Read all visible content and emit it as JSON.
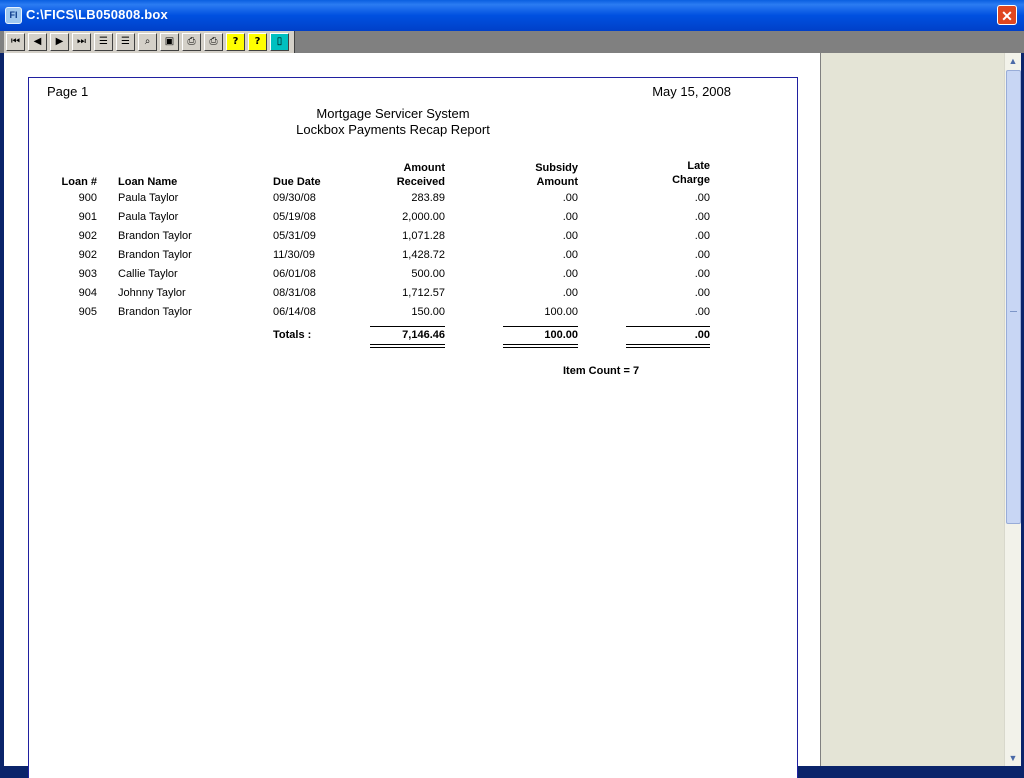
{
  "window": {
    "title": "C:\\FICS\\LB050808.box",
    "icon": "document-viewer-icon"
  },
  "toolbar": {
    "buttons": [
      {
        "name": "first-page-button",
        "glyph": "⏮"
      },
      {
        "name": "prev-page-button",
        "glyph": "◀"
      },
      {
        "name": "next-page-button",
        "glyph": "▶"
      },
      {
        "name": "last-page-button",
        "glyph": "⏭"
      },
      {
        "name": "page-button",
        "glyph": "☰"
      },
      {
        "name": "pages-button",
        "glyph": "☰"
      },
      {
        "name": "find-button",
        "glyph": "⌕"
      },
      {
        "name": "save-button",
        "glyph": "▣"
      },
      {
        "name": "print-setup-button",
        "glyph": "⎙"
      },
      {
        "name": "print-button",
        "glyph": "⎙"
      },
      {
        "name": "help-button",
        "glyph": "?"
      },
      {
        "name": "help-topics-button",
        "glyph": "?"
      },
      {
        "name": "exit-button",
        "glyph": "▯"
      }
    ]
  },
  "report": {
    "page_label": "Page 1",
    "date": "May 15, 2008",
    "title_line1": "Mortgage Servicer System",
    "title_line2": "Lockbox Payments Recap Report",
    "headers": {
      "loan_num": "Loan #",
      "loan_name": "Loan Name",
      "due_date": "Due Date",
      "amount_top": "Amount",
      "amount_bottom": "Received",
      "subsidy_top": "Subsidy",
      "subsidy_bottom": "Amount",
      "late_top": "Late",
      "late_bottom": "Charge"
    },
    "rows": [
      {
        "loan": "900",
        "name": "Paula Taylor",
        "due": "09/30/08",
        "amount": "283.89",
        "subsidy": ".00",
        "late": ".00"
      },
      {
        "loan": "901",
        "name": "Paula Taylor",
        "due": "05/19/08",
        "amount": "2,000.00",
        "subsidy": ".00",
        "late": ".00"
      },
      {
        "loan": "902",
        "name": "Brandon Taylor",
        "due": "05/31/09",
        "amount": "1,071.28",
        "subsidy": ".00",
        "late": ".00"
      },
      {
        "loan": "902",
        "name": "Brandon Taylor",
        "due": "11/30/09",
        "amount": "1,428.72",
        "subsidy": ".00",
        "late": ".00"
      },
      {
        "loan": "903",
        "name": "Callie Taylor",
        "due": "06/01/08",
        "amount": "500.00",
        "subsidy": ".00",
        "late": ".00"
      },
      {
        "loan": "904",
        "name": "Johnny Taylor",
        "due": "08/31/08",
        "amount": "1,712.57",
        "subsidy": ".00",
        "late": ".00"
      },
      {
        "loan": "905",
        "name": "Brandon Taylor",
        "due": "06/14/08",
        "amount": "150.00",
        "subsidy": "100.00",
        "late": ".00"
      }
    ],
    "totals": {
      "label": "Totals :",
      "amount": "7,146.46",
      "subsidy": "100.00",
      "late": ".00"
    },
    "item_count": "Item Count = 7"
  }
}
